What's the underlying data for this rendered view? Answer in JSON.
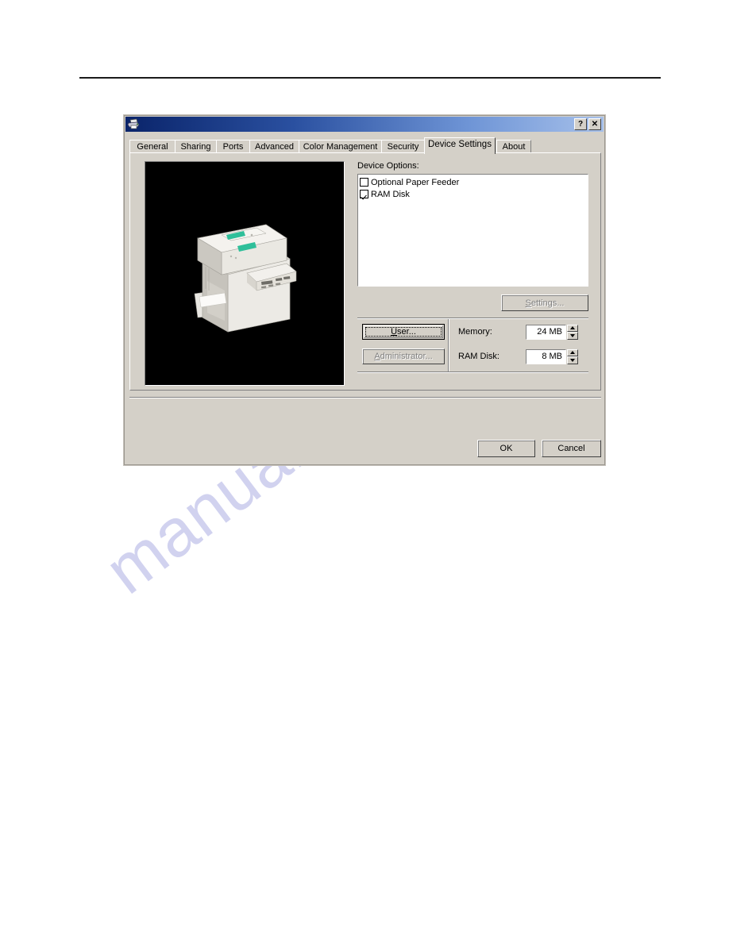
{
  "dialog": {
    "title": "",
    "title_icon": "printer-icon",
    "titlebar_buttons": [
      {
        "name": "help-button",
        "label": "?"
      },
      {
        "name": "close-button",
        "label": "✕"
      }
    ],
    "tabs": [
      {
        "label": "General",
        "active": false
      },
      {
        "label": "Sharing",
        "active": false
      },
      {
        "label": "Ports",
        "active": false
      },
      {
        "label": "Advanced",
        "active": false
      },
      {
        "label": "Color Management",
        "active": false
      },
      {
        "label": "Security",
        "active": false
      },
      {
        "label": "Device Settings",
        "active": true
      },
      {
        "label": "About",
        "active": false
      }
    ],
    "preview": {
      "alt": "printer-preview-image",
      "background": "#000000"
    },
    "device_options": {
      "label": "Device Options:",
      "items": [
        {
          "label": "Optional Paper Feeder",
          "checked": false
        },
        {
          "label": "RAM Disk",
          "checked": true
        }
      ]
    },
    "settings_button": {
      "label": "Settings...",
      "accel": "S",
      "enabled": false
    },
    "user_button": {
      "label": "User...",
      "accel": "U",
      "enabled": true,
      "focused": true
    },
    "administrator_button": {
      "label": "Administrator...",
      "accel": "A",
      "enabled": false
    },
    "fields": [
      {
        "name": "memory",
        "label": "Memory:",
        "value": "24 MB"
      },
      {
        "name": "ram-disk",
        "label": "RAM Disk:",
        "value": "8 MB"
      }
    ],
    "footer_buttons": [
      {
        "name": "ok-button",
        "label": "OK"
      },
      {
        "name": "cancel-button",
        "label": "Cancel"
      }
    ]
  },
  "page": {
    "watermark": "manualshive.com"
  },
  "colors": {
    "dialog_face": "#d4d0c8",
    "titlebar_start": "#0a246a",
    "titlebar_end": "#a6c0ea",
    "field_bg": "#ffffff",
    "disabled_text": "#808080",
    "watermark": "#c9cbed"
  }
}
